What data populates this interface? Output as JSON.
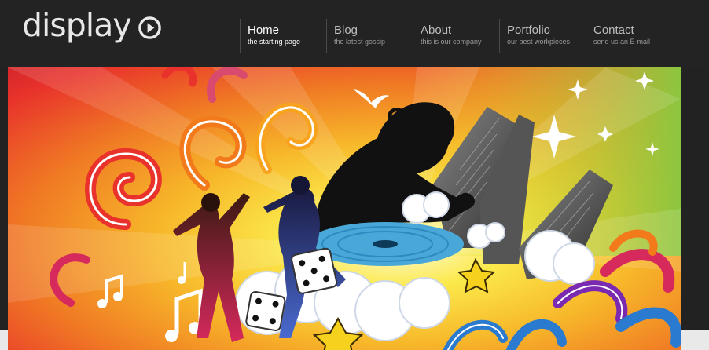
{
  "logo": {
    "text": "display",
    "icon": "play-circle-icon"
  },
  "nav": {
    "items": [
      {
        "label": "Home",
        "sub": "the starting page",
        "active": true
      },
      {
        "label": "Blog",
        "sub": "the latest gossip",
        "active": false
      },
      {
        "label": "About",
        "sub": "this is our company",
        "active": false
      },
      {
        "label": "Portfolio",
        "sub": "our best workpieces",
        "active": false
      },
      {
        "label": "Contact",
        "sub": "send us an E-mail",
        "active": false
      }
    ]
  },
  "colors": {
    "header_bg": "#232323",
    "banner_red": "#e8322b",
    "banner_orange": "#f7931e",
    "banner_yellow": "#f6e733",
    "banner_green": "#8cc63f",
    "silhouette": "#111111"
  }
}
